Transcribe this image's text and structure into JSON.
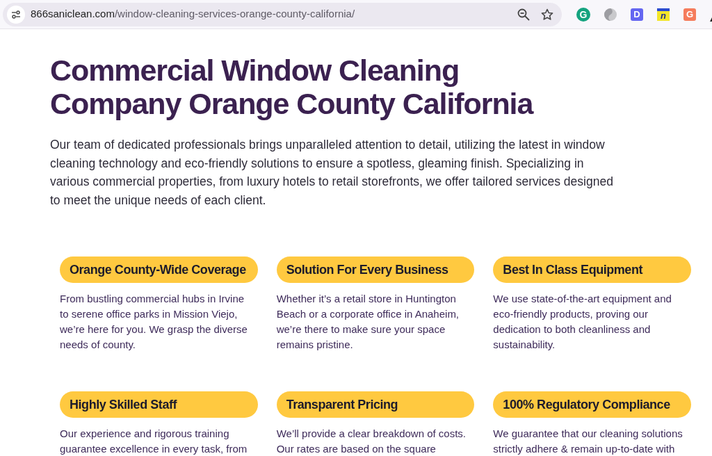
{
  "browser": {
    "address_bar": {
      "host": "866saniclean.com",
      "path": "/window-cleaning-services-orange-county-california/"
    },
    "extensions": [
      {
        "kind": "circle",
        "letter": "G",
        "color": "#14a37f"
      },
      {
        "kind": "swirl",
        "color": "#c9c9cc"
      },
      {
        "kind": "tile",
        "letter": "D",
        "color": "#6466f1"
      },
      {
        "kind": "banner",
        "letter": "n",
        "color": "#f3e62a"
      },
      {
        "kind": "tile",
        "letter": "G",
        "color": "#f57c5c"
      },
      {
        "kind": "clipped",
        "color": "#222222"
      }
    ]
  },
  "page": {
    "title": "Commercial Window Cleaning Company Orange County California",
    "intro": "Our team of dedicated professionals brings unparalleled attention to detail, utilizing the latest in window cleaning technology and eco-friendly solutions to ensure a spotless, gleaming finish. Specializing in various commercial properties, from luxury hotels to retail storefronts, we offer tailored services designed to meet the unique needs of each client.",
    "features": [
      {
        "title": "Orange County-Wide Coverage",
        "text": "From bustling commercial hubs in Irvine to serene office parks in Mission Viejo, we’re here for you. We grasp the diverse needs of county."
      },
      {
        "title": "Solution For Every Business",
        "text": "Whether it’s a retail store in Huntington Beach or a corporate office in Anaheim, we’re there to make sure your space remains pristine."
      },
      {
        "title": "Best In Class Equipment",
        "text": "We use state-of-the-art equipment and eco-friendly products, proving our dedication to both cleanliness and sustainability."
      },
      {
        "title": "Highly Skilled Staff",
        "text": "Our experience and rigorous training guarantee excellence in every task, from"
      },
      {
        "title": "Transparent Pricing",
        "text": "We’ll provide a clear breakdown of costs. Our rates are based on the square"
      },
      {
        "title": "100% Regulatory Compliance",
        "text": "We guarantee that our cleaning solutions strictly adhere & remain up-to-date with"
      }
    ]
  }
}
